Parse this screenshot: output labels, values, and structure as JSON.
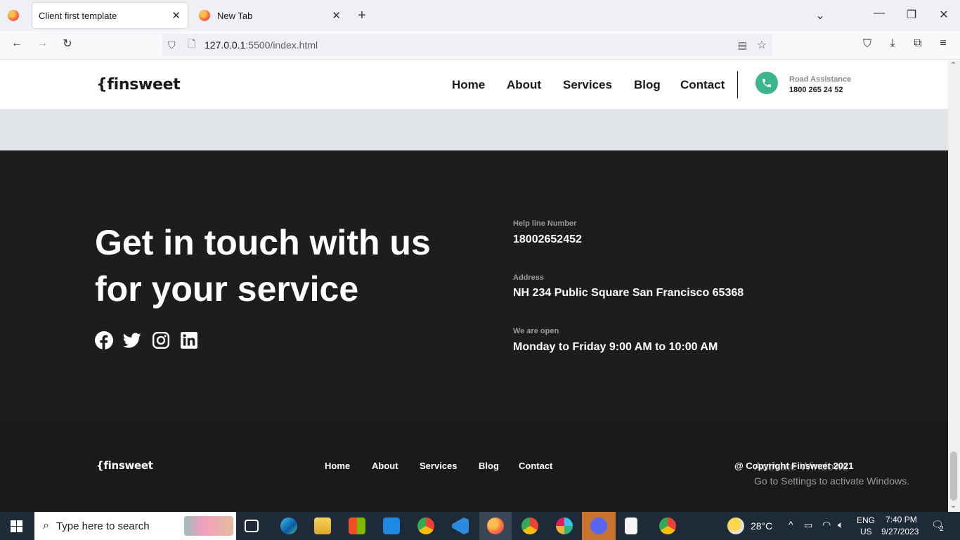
{
  "browser": {
    "tabs": [
      {
        "title": "Client first template",
        "active": true
      },
      {
        "title": "New Tab",
        "active": false
      }
    ],
    "url_host": "127.0.0.1",
    "url_rest": ":5500/index.html"
  },
  "header": {
    "logo": "{finsweet",
    "nav": [
      "Home",
      "About",
      "Services",
      "Blog",
      "Contact"
    ],
    "road_label": "Road Assistance",
    "road_phone": "1800 265 24 52"
  },
  "contact": {
    "headline_line1": "Get in touch with us",
    "headline_line2": "for your service",
    "helpline_label": "Help line Number",
    "helpline_value": "18002652452",
    "address_label": "Address",
    "address_value": "NH 234 Public Square San Francisco 65368",
    "open_label": "We are open",
    "open_value": "Monday to Friday 9:00 AM to 10:00 AM"
  },
  "footer": {
    "logo": "{finsweet",
    "nav": [
      "Home",
      "About",
      "Services",
      "Blog",
      "Contact"
    ],
    "copyright": "@ Copyright Finsweet 2021"
  },
  "watermark": {
    "line1": "Activate Windows",
    "line2": "Go to Settings to activate Windows."
  },
  "taskbar": {
    "search_placeholder": "Type here to search",
    "weather": "28°C",
    "lang1": "ENG",
    "lang2": "US",
    "time": "7:40 PM",
    "date": "9/27/2023",
    "notifications": "2"
  },
  "colors": {
    "accent_green": "#3bb589",
    "dark_bg": "#1e1d1c",
    "gray_band": "#e2e5e9"
  }
}
